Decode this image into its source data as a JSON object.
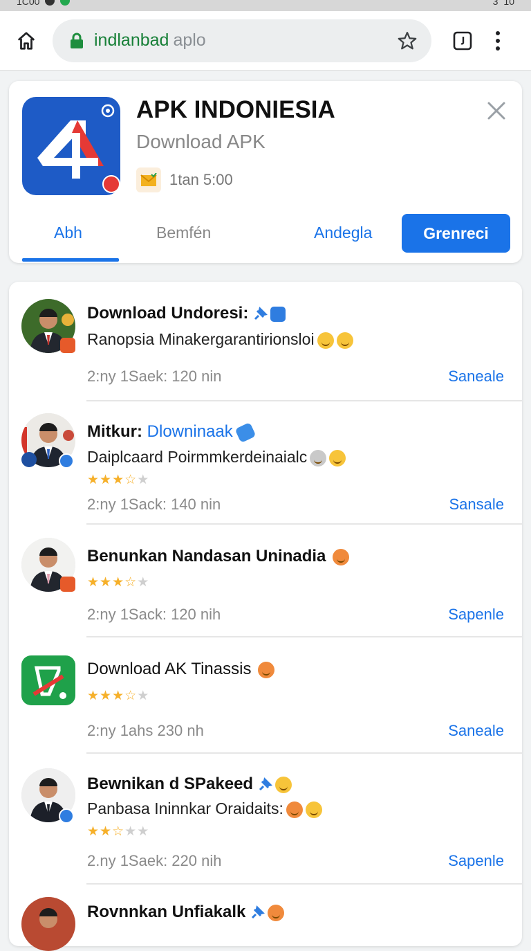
{
  "status_bar": {
    "time": "1C00",
    "signal": "3",
    "battery": "10"
  },
  "browser": {
    "url_host": "indlanbad",
    "url_path": "aplo",
    "icons": [
      "home-icon",
      "lock-icon",
      "star-icon",
      "tab-switcher-icon",
      "more-vert-icon"
    ]
  },
  "app": {
    "title": "APK INDONIESIA",
    "subtitle": "Download APK",
    "update_time": "1tan 5:00",
    "tabs": [
      "Abh",
      "Bemfén",
      "Andegla"
    ],
    "primary_button": "Grenreci",
    "accent_color": "#1a73e8"
  },
  "list": [
    {
      "title": "Download Undoresi:",
      "title_style": "bold",
      "desc": "Ranopsia Minakergarantirionsloi",
      "rating": null,
      "meta": "2:ny 1Saek: 120 nin",
      "action": "Saneale"
    },
    {
      "title": "Mitkur:",
      "title_link": "Dlowninaak",
      "title_style": "bold",
      "desc": "Daiplcaard Poirmmkerdeinaialc",
      "rating": 3.5,
      "meta": "2:ny 1Sack: 140 nin",
      "action": "Sansale"
    },
    {
      "title": "Benunkan Nandasan Uninadia",
      "title_style": "bold",
      "desc": "",
      "rating": 3.5,
      "meta": "2:ny 1Sack: 120 nih",
      "action": "Sapenle"
    },
    {
      "title": "Download AK Tinassis",
      "title_style": "normal",
      "desc": "",
      "rating": 3.5,
      "meta": "2:ny 1ahs 230 nh",
      "action": "Saneale"
    },
    {
      "title": "Bewnikan d SPakeed",
      "title_style": "bold",
      "desc": "Panbasa Ininnkar Oraidaits:",
      "rating": 2.5,
      "meta": "2.ny 1Saek: 220 nih",
      "action": "Sapenle"
    },
    {
      "title": "Rovnnkan Unfiakalk",
      "title_style": "bold",
      "desc": "",
      "rating": null,
      "meta": "",
      "action": ""
    }
  ]
}
